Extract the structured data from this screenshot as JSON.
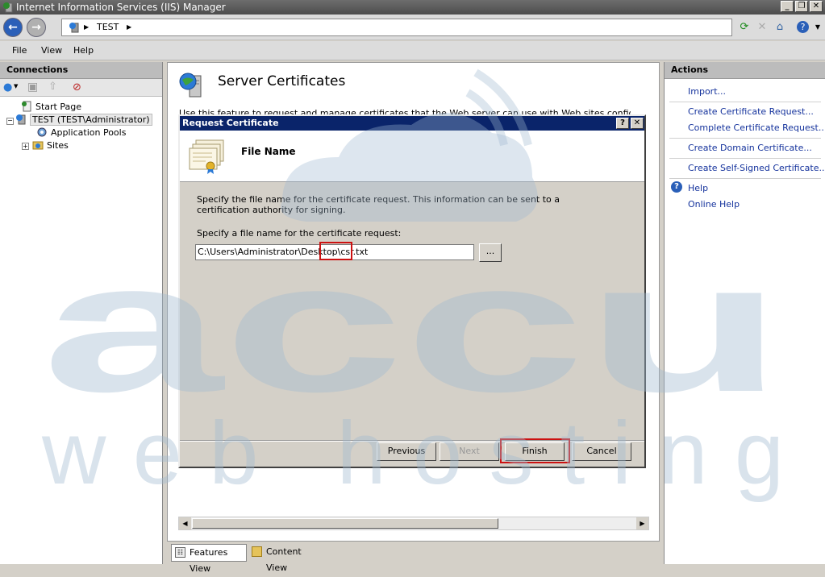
{
  "window": {
    "title": "Internet Information Services (IIS) Manager"
  },
  "address": {
    "path": "TEST",
    "separator": "▶"
  },
  "menu": {
    "items": [
      {
        "label": "File"
      },
      {
        "label": "View"
      },
      {
        "label": "Help"
      }
    ]
  },
  "connections": {
    "title": "Connections",
    "tree": [
      {
        "label": "Start Page"
      },
      {
        "label": "TEST (TEST\\Administrator)"
      },
      {
        "label": "Application Pools"
      },
      {
        "label": "Sites"
      }
    ]
  },
  "main": {
    "title": "Server Certificates",
    "description": "Use this feature to request and manage certificates that the Web server can use with Web sites configured for SSL."
  },
  "actions": {
    "title": "Actions",
    "links": [
      {
        "label": "Import..."
      },
      {
        "label": "Create Certificate Request..."
      },
      {
        "label": "Complete Certificate Request..."
      },
      {
        "label": "Create Domain Certificate..."
      },
      {
        "label": "Create Self-Signed Certificate..."
      },
      {
        "label": "Help"
      },
      {
        "label": "Online Help"
      }
    ]
  },
  "dialog": {
    "title": "Request Certificate",
    "help_btn": "?",
    "close_btn": "✕",
    "header": "File Name",
    "instructions": "Specify the file name for the certificate request. This information can be sent to a certification authority for signing.",
    "field_label": "Specify a file name for the certificate request:",
    "filename": "C:\\Users\\Administrator\\Desktop\\csr.txt",
    "browse_label": "...",
    "buttons": {
      "previous": "Previous",
      "next": "Next",
      "finish": "Finish",
      "cancel": "Cancel"
    }
  },
  "bottom_tabs": {
    "features_view": "Features View",
    "content_view": "Content View"
  },
  "watermark": {
    "line1": "accu",
    "line2": "web hosting"
  },
  "colors": {
    "dialog_title": "#0a246a",
    "link": "#14329c",
    "highlight": "#cc1111",
    "watermark": "#b8cadb"
  }
}
